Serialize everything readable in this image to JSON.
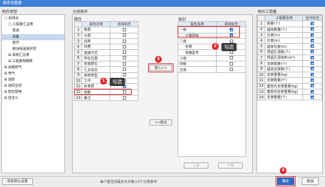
{
  "window": {
    "title": "报表设置器"
  },
  "left_panel": {
    "header": "构件类型",
    "tree": [
      {
        "text": "□ 给排水",
        "indent": 0,
        "selected": false
      },
      {
        "text": "□ 工程量汇总表",
        "indent": 1,
        "selected": false
      },
      {
        "text": "管道",
        "indent": 2,
        "selected": false
      },
      {
        "text": "设备",
        "indent": 2,
        "selected": true
      },
      {
        "text": "管件",
        "indent": 2,
        "selected": false
      },
      {
        "text": "刷油保温保护层",
        "indent": 2,
        "selected": false
      },
      {
        "text": "⊞ 系统汇总表",
        "indent": 1,
        "selected": false
      },
      {
        "text": "⊞ 工程量明细表",
        "indent": 1,
        "selected": false
      },
      {
        "text": "⊞ 采暖燃气",
        "indent": 0,
        "selected": false
      },
      {
        "text": "⊞ 电气",
        "indent": 0,
        "selected": false
      },
      {
        "text": "⊞ 消防",
        "indent": 0,
        "selected": false
      },
      {
        "text": "⊞ 通风空调",
        "indent": 0,
        "selected": false
      },
      {
        "text": "⊞ 智控弱电",
        "indent": 0,
        "selected": false
      },
      {
        "text": "⊞ 自定义",
        "indent": 0,
        "selected": false
      }
    ]
  },
  "classify": {
    "header": "分类条件",
    "attr_label": "属性",
    "col_name": "属性名称",
    "col_add": "添加标志",
    "rows": [
      {
        "num": "1",
        "name": "楼层",
        "checked": false
      },
      {
        "num": "2",
        "name": "分层",
        "checked": false
      },
      {
        "num": "3",
        "name": "名称",
        "checked": false
      },
      {
        "num": "4",
        "name": "材质",
        "checked": false
      },
      {
        "num": "5",
        "name": "连接方式",
        "checked": false
      },
      {
        "num": "6",
        "name": "所在位置",
        "checked": false
      },
      {
        "num": "7",
        "name": "安装部位",
        "checked": false
      },
      {
        "num": "8",
        "name": "汇总信息",
        "checked": false
      },
      {
        "num": "9",
        "name": "系统类型",
        "checked": false
      },
      {
        "num": "10",
        "name": "工作",
        "checked": false
      },
      {
        "num": "11",
        "name": "标准层",
        "checked": true
      },
      {
        "num": "12",
        "name": "倍数",
        "checked": false
      },
      {
        "num": "13",
        "name": "备注",
        "checked": false
      }
    ],
    "insert_button": "插入>>",
    "remove_button": "<<移出"
  },
  "levels": {
    "header": "级别",
    "col_name": "属性名称",
    "col_add": "添加标志",
    "rows": [
      {
        "num": "",
        "name": "一级",
        "checked": true
      },
      {
        "num": "",
        "name": "计算层级",
        "checked": true
      },
      {
        "num": "",
        "name": "二级",
        "checked": false
      },
      {
        "num": "",
        "name": "名称",
        "checked": false
      },
      {
        "num": "",
        "name": "规格型号",
        "checked": false
      },
      {
        "num": "",
        "name": "三级",
        "checked": false
      },
      {
        "num": "",
        "name": "四级",
        "checked": false
      },
      {
        "num": "",
        "name": "五级",
        "checked": false
      }
    ],
    "up_button": "上移",
    "down_button": "下移"
  },
  "quantity": {
    "header": "构件工程量",
    "col_name": "工程量名称",
    "col_show": "显示标志",
    "rows": [
      {
        "num": "1",
        "name": "数量(个)",
        "checked": true
      },
      {
        "num": "2",
        "name": "超高数量(个)",
        "checked": true
      },
      {
        "num": "3",
        "name": "长度(m)",
        "checked": true
      },
      {
        "num": "4",
        "name": "长度(m)",
        "checked": true
      },
      {
        "num": "5",
        "name": "超高长度(m)",
        "checked": true
      },
      {
        "num": "6",
        "name": "预留孔洞数(个)",
        "checked": true
      },
      {
        "num": "7",
        "name": "预留孔洞体积(m³)",
        "checked": true
      },
      {
        "num": "8",
        "name": "支架数量(个)",
        "checked": true
      },
      {
        "num": "9",
        "name": "超高支架数(个)",
        "checked": true
      },
      {
        "num": "10",
        "name": "支架重量(kg)",
        "checked": true
      },
      {
        "num": "11",
        "name": "支架数量(个)",
        "checked": true
      },
      {
        "num": "12",
        "name": "套管内支架重量(kg)",
        "checked": true
      },
      {
        "num": "13",
        "name": "套管内支架重量(kg)",
        "checked": true
      },
      {
        "num": "14",
        "name": "支架数量(个)",
        "checked": true
      }
    ]
  },
  "annotations": {
    "step1": "1",
    "step2": "2",
    "step3": "3",
    "step4": "4",
    "tip1": "勾选",
    "tip2": "勾选"
  },
  "footer": {
    "restore_button": "恢复默认设置",
    "status_text": "每个报当前最多允许移入5个分类条件",
    "ok_button": "确定",
    "cancel_button": "取消"
  },
  "colors": {
    "accent": "#2d6cc4",
    "annotation": "#e3262a",
    "titlebar": "#3c7fd6"
  }
}
